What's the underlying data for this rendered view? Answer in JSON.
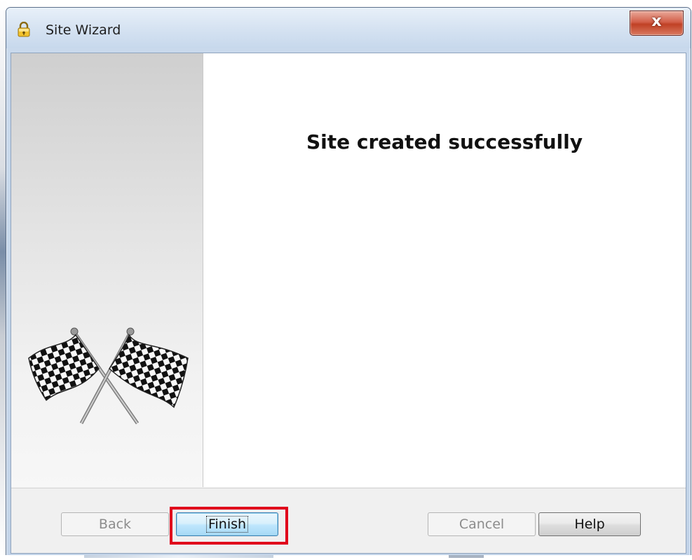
{
  "window": {
    "title": "Site Wizard",
    "close_label": "x"
  },
  "content": {
    "headline": "Site created successfully"
  },
  "footer": {
    "back_label": "Back",
    "finish_label": "Finish",
    "cancel_label": "Cancel",
    "help_label": "Help"
  },
  "icons": {
    "title": "padlock-icon",
    "side_image": "checkered-flags-icon"
  },
  "colors": {
    "highlight": "#e0001b",
    "default_button": "#3c7fb1"
  }
}
